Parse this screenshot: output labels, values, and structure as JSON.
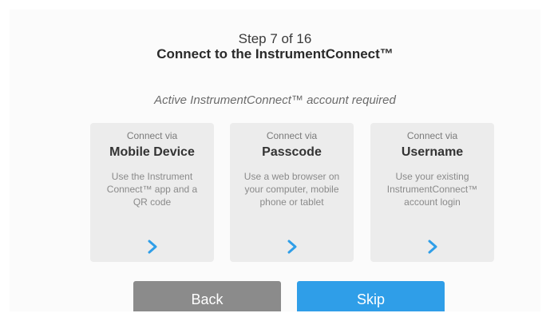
{
  "header": {
    "step": "Step 7 of 16",
    "title": "Connect to the InstrumentConnect™"
  },
  "subtitle": "Active InstrumentConnect™ account required",
  "options": [
    {
      "via": "Connect via",
      "name": "Mobile Device",
      "description": "Use the Instrument Connect™ app and a QR code",
      "icon": "chevron-right-icon"
    },
    {
      "via": "Connect via",
      "name": "Passcode",
      "description": "Use a web browser on your computer, mobile phone or tablet",
      "icon": "chevron-right-icon"
    },
    {
      "via": "Connect via",
      "name": "Username",
      "description": "Use your existing InstrumentConnect™ account login",
      "icon": "chevron-right-icon"
    }
  ],
  "buttons": {
    "back": "Back",
    "skip": "Skip"
  },
  "colors": {
    "accent": "#2f9ee8",
    "back_button": "#8b8b8b",
    "card_background": "#ececec"
  }
}
